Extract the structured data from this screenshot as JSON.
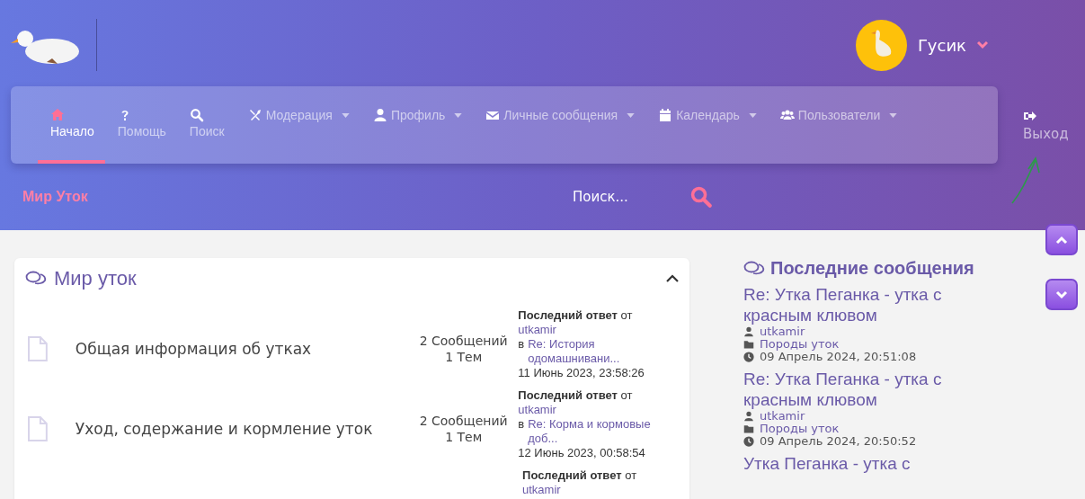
{
  "header": {
    "user": {
      "name": "Гусик"
    }
  },
  "nav": {
    "items": [
      {
        "label": "Начало",
        "dropdown": false,
        "selected": true
      },
      {
        "label": "Помощь",
        "dropdown": false,
        "selected": false
      },
      {
        "label": "Поиск",
        "dropdown": false,
        "selected": false
      },
      {
        "label": "Модерация",
        "dropdown": true,
        "selected": false
      },
      {
        "label": "Профиль",
        "dropdown": true,
        "selected": false
      },
      {
        "label": "Личные сообщения",
        "dropdown": true,
        "selected": false
      },
      {
        "label": "Календарь",
        "dropdown": true,
        "selected": false
      },
      {
        "label": "Пользователи",
        "dropdown": true,
        "selected": false
      }
    ],
    "logout": {
      "label": "Выход"
    }
  },
  "breadcrumb": "Мир Уток",
  "search": {
    "placeholder": "Поиск..."
  },
  "board_section": {
    "title": "Мир уток",
    "expanded": true,
    "boards": [
      {
        "name": "Общая информация об утках",
        "stats": [
          "2 Сообщений",
          "1 Тем"
        ],
        "last_post": {
          "label": "**Последний ответ** от",
          "user": "utkamir",
          "in": "в",
          "topic": "Re: История одомашнивани...",
          "date": "11 Июнь 2023, 23:58:26"
        }
      },
      {
        "name": "Уход, содержание и кормление уток",
        "stats": [
          "2 Сообщений",
          "1 Тем"
        ],
        "last_post": {
          "label": "**Последний ответ** от",
          "user": "utkamir",
          "in": "в",
          "topic": "Re: Корма и кормовые доб...",
          "date": "12 Июнь 2023, 00:58:54"
        }
      },
      {
        "last_post": {
          "label": "**Последний ответ** от",
          "user": "utkamir"
        }
      }
    ]
  },
  "recent": {
    "title": "Последние сообщения",
    "items": [
      {
        "title": "Re: Утка Пеганка - утка с красным клювом",
        "user": "utkamir",
        "board": "Породы уток",
        "date": "09 Апрель 2024, 20:51:08"
      },
      {
        "title": "Re: Утка Пеганка - утка с красным клювом",
        "user": "utkamir",
        "board": "Породы уток",
        "date": "09 Апрель 2024, 20:50:52"
      },
      {
        "title": "Утка Пеганка - утка с"
      }
    ]
  }
}
